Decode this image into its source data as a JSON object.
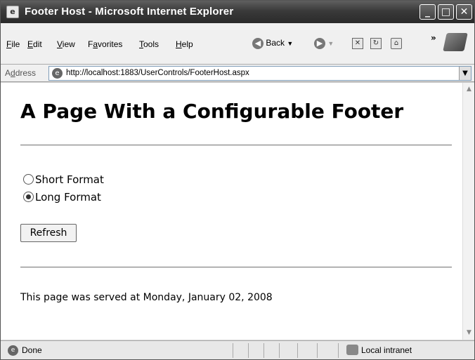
{
  "window": {
    "title": "Footer Host - Microsoft Internet Explorer",
    "controls": {
      "minimize": "_",
      "maximize": "□",
      "close": "✕"
    }
  },
  "menu": {
    "items": [
      {
        "key": "F",
        "rest": "ile"
      },
      {
        "key": "E",
        "rest": "dit"
      },
      {
        "key": "V",
        "rest": "iew"
      },
      {
        "key": "a",
        "pre": "F",
        "rest": "vorites"
      },
      {
        "key": "T",
        "rest": "ools"
      },
      {
        "key": "H",
        "rest": "elp"
      }
    ],
    "back_label": "Back",
    "overflow": "»"
  },
  "address": {
    "label_pre": "A",
    "label_key": "d",
    "label_rest": "dress",
    "url": "http://localhost:1883/UserControls/FooterHost.aspx"
  },
  "page": {
    "heading": "A Page With a Configurable Footer",
    "options": [
      {
        "label": "Short Format",
        "selected": false
      },
      {
        "label": "Long Format",
        "selected": true
      }
    ],
    "refresh_label": "Refresh",
    "footer_text": "This page was served at Monday, January 02, 2008"
  },
  "status": {
    "text": "Done",
    "zone": "Local intranet"
  },
  "icons": {
    "app": "ie-icon",
    "back": "back-arrow-icon",
    "forward": "forward-arrow-icon",
    "stop": "stop-icon",
    "refresh": "refresh-icon",
    "home": "home-icon",
    "page": "page-icon",
    "zone": "intranet-icon"
  }
}
